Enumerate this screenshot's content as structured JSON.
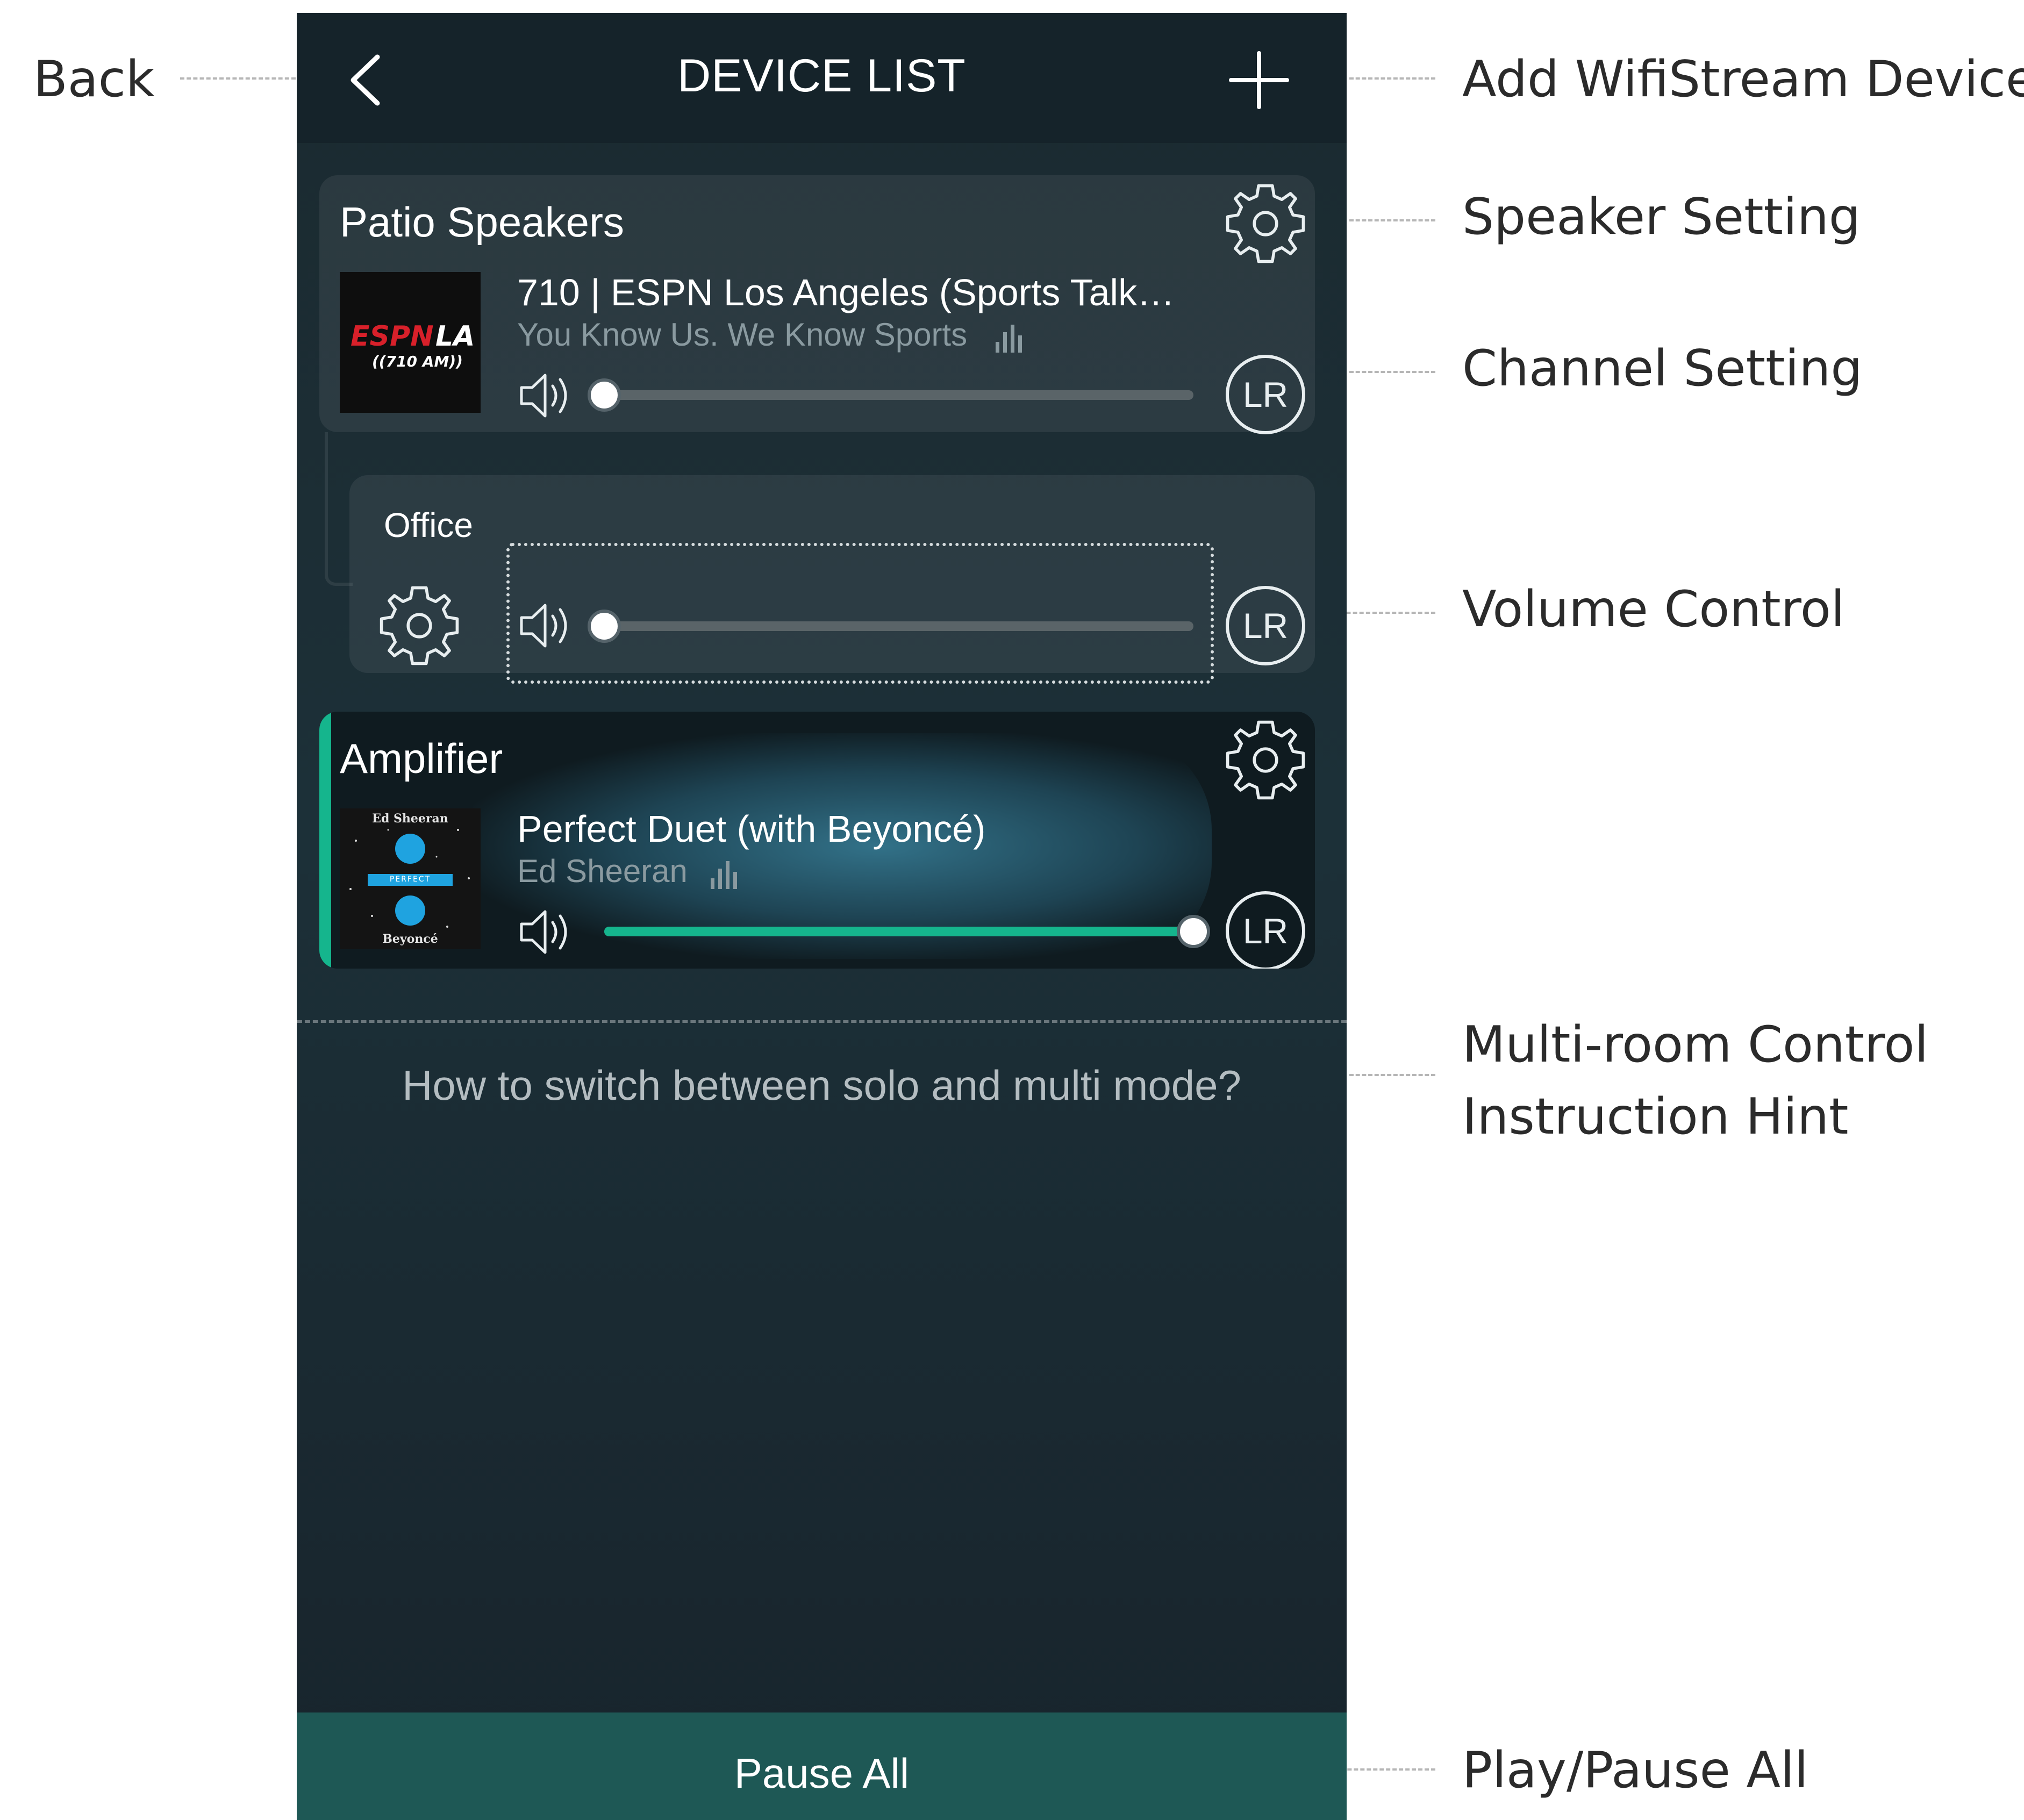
{
  "callouts": {
    "back": "Back",
    "add_device": "Add WifiStream Device",
    "speaker_setting": "Speaker Setting",
    "channel_setting": "Channel Setting",
    "volume_control": "Volume Control",
    "multiroom_hint_line1": "Multi-room Control",
    "multiroom_hint_line2": "Instruction Hint",
    "play_pause_all": "Play/Pause All"
  },
  "header": {
    "title": "DEVICE LIST",
    "back_icon": "chevron-left-icon",
    "add_icon": "plus-icon"
  },
  "devices": [
    {
      "name": "Patio Speakers",
      "artwork": {
        "brand": "ESPN",
        "suffix": "LA",
        "freq": "((710 AM))"
      },
      "track": "710 | ESPN Los Angeles (Sports Talk…",
      "subtitle": "You Know Us. We Know Sports",
      "volume": 0,
      "channel": "LR",
      "active": false
    },
    {
      "name": "Office",
      "volume": 0,
      "channel": "LR",
      "active": false
    },
    {
      "name": "Amplifier",
      "artwork": {
        "artist_top": "Ed Sheeran",
        "title_band": "PERFECT",
        "artist_bottom": "Beyoncé"
      },
      "track": "Perfect Duet (with Beyoncé)",
      "subtitle": "Ed Sheeran",
      "volume": 100,
      "channel": "LR",
      "active": true
    }
  ],
  "hint": "How to switch between solo and multi mode?",
  "footer": {
    "label": "Pause All"
  },
  "colors": {
    "accent": "#15b58d",
    "background": "#1c2c33",
    "footer": "#1e5855"
  }
}
